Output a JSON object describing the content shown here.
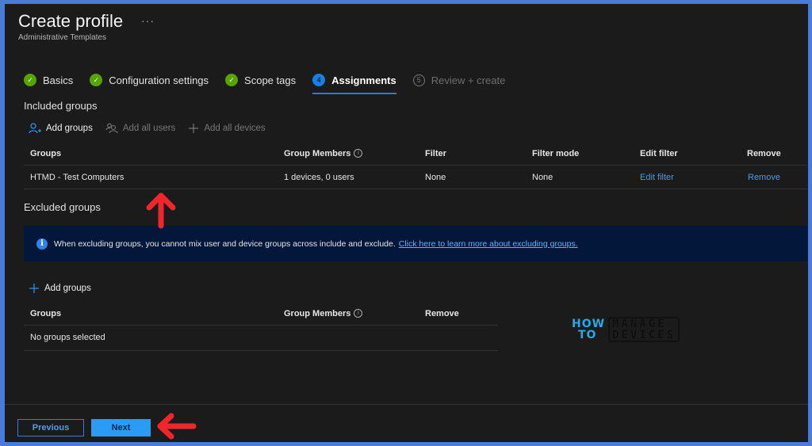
{
  "header": {
    "title": "Create profile",
    "more_label": "···",
    "subtitle": "Administrative Templates"
  },
  "wizard_steps": [
    {
      "label": "Basics",
      "state": "done",
      "marker": "✓"
    },
    {
      "label": "Configuration settings",
      "state": "done",
      "marker": "✓"
    },
    {
      "label": "Scope tags",
      "state": "done",
      "marker": "✓"
    },
    {
      "label": "Assignments",
      "state": "active",
      "marker": "4"
    },
    {
      "label": "Review + create",
      "state": "pending",
      "marker": "5"
    }
  ],
  "included": {
    "title": "Included groups",
    "commands": {
      "add_groups": "Add groups",
      "add_all_users": "Add all users",
      "add_all_devices": "Add all devices"
    },
    "columns": [
      "Groups",
      "Group Members",
      "Filter",
      "Filter mode",
      "Edit filter",
      "Remove"
    ],
    "rows": [
      {
        "group": "HTMD - Test Computers",
        "members": "1 devices, 0 users",
        "filter": "None",
        "filter_mode": "None",
        "edit_filter": "Edit filter",
        "remove": "Remove"
      }
    ]
  },
  "excluded": {
    "title": "Excluded groups",
    "info_icon": "i",
    "info_text": "When excluding groups, you cannot mix user and device groups across include and exclude.",
    "info_link": "Click here to learn more about excluding groups.",
    "add_groups": "Add groups",
    "columns": [
      "Groups",
      "Group Members",
      "Remove"
    ],
    "empty_text": "No groups selected"
  },
  "footer": {
    "previous": "Previous",
    "next": "Next"
  },
  "watermark": {
    "line1_left": "HOW",
    "line2_left": "TO",
    "line1_right": "MANAGE",
    "line2_right": "DEVICES"
  },
  "colors": {
    "accent": "#2b9bf4",
    "success": "#57a300",
    "link": "#4a9be8",
    "annotation_arrow": "#f0262c",
    "frame_border": "#4a7bd8"
  }
}
